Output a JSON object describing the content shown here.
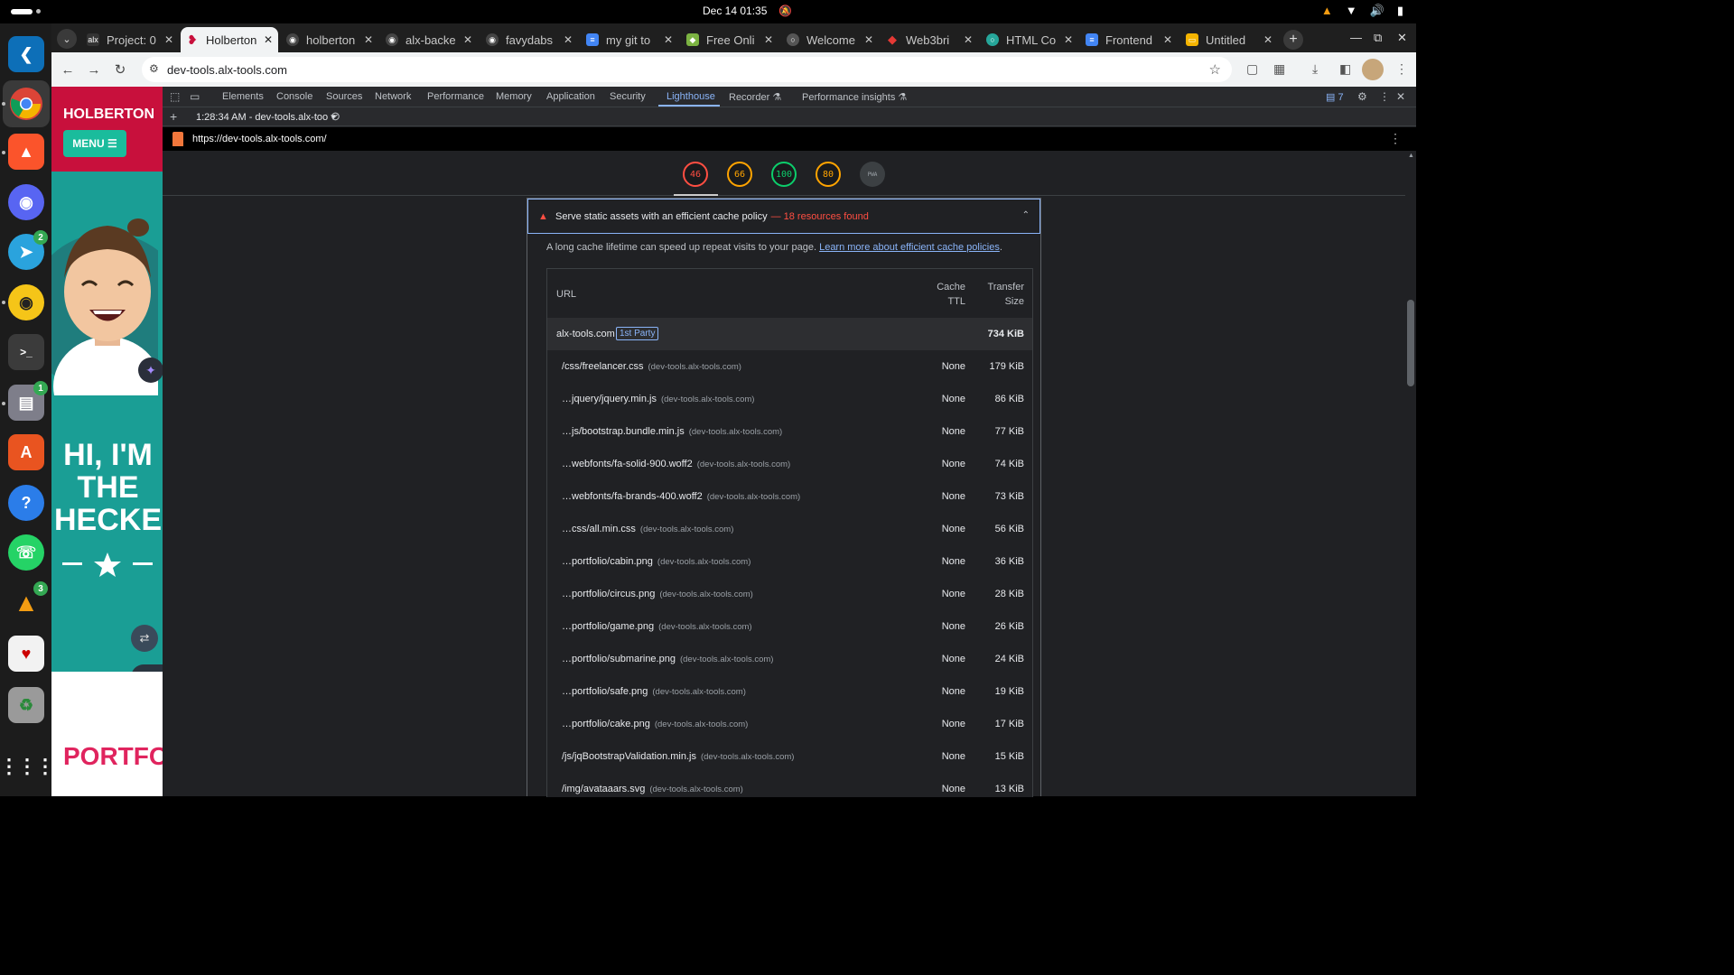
{
  "system": {
    "clock": "Dec 14  01:35"
  },
  "dock": {
    "items": [
      {
        "name": "vscode",
        "badge": ""
      },
      {
        "name": "chrome",
        "badge": ""
      },
      {
        "name": "brave",
        "badge": ""
      },
      {
        "name": "discord",
        "badge": ""
      },
      {
        "name": "telegram",
        "badge": "2"
      },
      {
        "name": "rhythmbox",
        "badge": ""
      },
      {
        "name": "terminal",
        "badge": ""
      },
      {
        "name": "files",
        "badge": "1"
      },
      {
        "name": "app-center",
        "badge": ""
      },
      {
        "name": "help",
        "badge": ""
      },
      {
        "name": "whatsapp",
        "badge": ""
      },
      {
        "name": "vlc",
        "badge": "3"
      },
      {
        "name": "solitaire",
        "badge": ""
      },
      {
        "name": "trash",
        "badge": ""
      }
    ]
  },
  "browser": {
    "tabs": [
      {
        "label": "Project: 0",
        "active": false
      },
      {
        "label": "Holberton",
        "active": true
      },
      {
        "label": "holberton",
        "active": false
      },
      {
        "label": "alx-backe",
        "active": false
      },
      {
        "label": "favydabs",
        "active": false
      },
      {
        "label": "my git to",
        "active": false
      },
      {
        "label": "Free Onli",
        "active": false
      },
      {
        "label": "Welcome",
        "active": false
      },
      {
        "label": "Web3bri",
        "active": false
      },
      {
        "label": "HTML Co",
        "active": false
      },
      {
        "label": "Frontend",
        "active": false
      },
      {
        "label": "Untitled",
        "active": false
      }
    ],
    "address": "dev-tools.alx-tools.com"
  },
  "webpage": {
    "brand": "HOLBERTON",
    "menu_label": "MENU ☰",
    "hero_text_1": "HI, I'M",
    "hero_text_2": "THE",
    "hero_text_3": "HECKE",
    "portfolio": "PORTFO"
  },
  "devtools": {
    "tabs": [
      "Elements",
      "Console",
      "Sources",
      "Network",
      "Performance",
      "Memory",
      "Application",
      "Security",
      "Lighthouse",
      "Recorder",
      "Performance insights"
    ],
    "active_tab": "Lighthouse",
    "issues_count": "7",
    "report_selector": "1:28:34 AM - dev-tools.alx-too",
    "lighthouse_url": "https://dev-tools.alx-tools.com/",
    "scores": [
      {
        "value": "46",
        "color": "#ff4e42"
      },
      {
        "value": "66",
        "color": "#ffa400"
      },
      {
        "value": "100",
        "color": "#0cce6b"
      },
      {
        "value": "80",
        "color": "#ffa400"
      },
      {
        "value": "PWA",
        "color": "#9aa0a6"
      }
    ],
    "audit": {
      "title": "Serve static assets with an efficient cache policy",
      "count": "— 18 resources found",
      "description": "A long cache lifetime can speed up repeat visits to your page.",
      "link": "Learn more about efficient cache policies",
      "desc_end": ".",
      "col_url": "URL",
      "col_ttl_1": "Cache",
      "col_ttl_2": "TTL",
      "col_size_1": "Transfer",
      "col_size_2": "Size",
      "group": {
        "name": "alx-tools.com",
        "badge": "1st Party",
        "size": "734 KiB"
      },
      "rows": [
        {
          "url": "/css/freelancer.css",
          "host": "(dev-tools.alx-tools.com)",
          "ttl": "None",
          "size": "179 KiB"
        },
        {
          "url": "…jquery/jquery.min.js",
          "host": "(dev-tools.alx-tools.com)",
          "ttl": "None",
          "size": "86 KiB"
        },
        {
          "url": "…js/bootstrap.bundle.min.js",
          "host": "(dev-tools.alx-tools.com)",
          "ttl": "None",
          "size": "77 KiB"
        },
        {
          "url": "…webfonts/fa-solid-900.woff2",
          "host": "(dev-tools.alx-tools.com)",
          "ttl": "None",
          "size": "74 KiB"
        },
        {
          "url": "…webfonts/fa-brands-400.woff2",
          "host": "(dev-tools.alx-tools.com)",
          "ttl": "None",
          "size": "73 KiB"
        },
        {
          "url": "…css/all.min.css",
          "host": "(dev-tools.alx-tools.com)",
          "ttl": "None",
          "size": "56 KiB"
        },
        {
          "url": "…portfolio/cabin.png",
          "host": "(dev-tools.alx-tools.com)",
          "ttl": "None",
          "size": "36 KiB"
        },
        {
          "url": "…portfolio/circus.png",
          "host": "(dev-tools.alx-tools.com)",
          "ttl": "None",
          "size": "28 KiB"
        },
        {
          "url": "…portfolio/game.png",
          "host": "(dev-tools.alx-tools.com)",
          "ttl": "None",
          "size": "26 KiB"
        },
        {
          "url": "…portfolio/submarine.png",
          "host": "(dev-tools.alx-tools.com)",
          "ttl": "None",
          "size": "24 KiB"
        },
        {
          "url": "…portfolio/safe.png",
          "host": "(dev-tools.alx-tools.com)",
          "ttl": "None",
          "size": "19 KiB"
        },
        {
          "url": "…portfolio/cake.png",
          "host": "(dev-tools.alx-tools.com)",
          "ttl": "None",
          "size": "17 KiB"
        },
        {
          "url": "/js/jqBootstrapValidation.min.js",
          "host": "(dev-tools.alx-tools.com)",
          "ttl": "None",
          "size": "15 KiB"
        },
        {
          "url": "/img/avataaars.svg",
          "host": "(dev-tools.alx-tools.com)",
          "ttl": "None",
          "size": "13 KiB"
        }
      ]
    }
  }
}
